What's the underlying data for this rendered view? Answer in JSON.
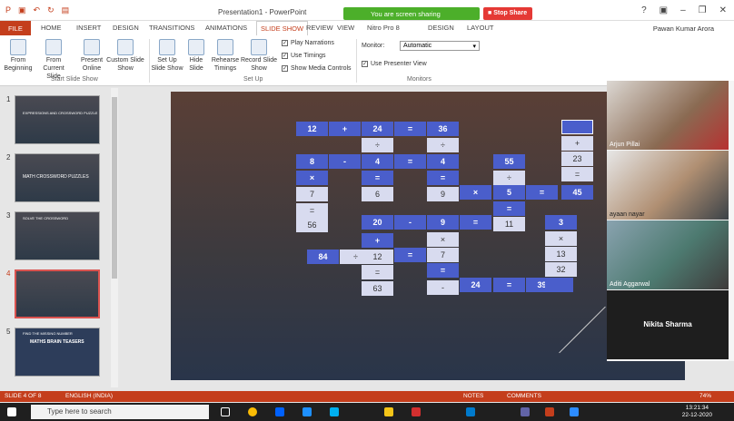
{
  "window": {
    "title": "Presentation1 - PowerPoint",
    "user": "Pawan Kumar Arora"
  },
  "sharing": {
    "status": "You are screen sharing",
    "stop": "Stop Share"
  },
  "tabs": [
    "FILE",
    "HOME",
    "INSERT",
    "DESIGN",
    "TRANSITIONS",
    "ANIMATIONS",
    "SLIDE SHOW",
    "REVIEW",
    "VIEW",
    "Nitro Pro 8",
    "DESIGN",
    "LAYOUT"
  ],
  "ribbon": {
    "from_beginning": "From Beginning",
    "from_current": "From Current Slide",
    "present_online": "Present Online",
    "custom_show": "Custom Slide Show",
    "group_start": "Start Slide Show",
    "set_up": "Set Up Slide Show",
    "hide": "Hide Slide",
    "rehearse": "Rehearse Timings",
    "record": "Record Slide Show",
    "play_narrations": "Play Narrations",
    "use_timings": "Use Timings",
    "show_media": "Show Media Controls",
    "group_setup": "Set Up",
    "monitor_label": "Monitor:",
    "monitor_value": "Automatic",
    "presenter_view": "Use Presenter View",
    "group_monitors": "Monitors"
  },
  "thumbs": {
    "t1": "EXPRESSIONS AND CROSSWORD PUZZLE",
    "t2": "MATH CROSSWORD PUZZLES",
    "t3": "SOLVE THE CROSSWORD",
    "t5a": "FIND THE MISSING NUMBER",
    "t5b": "MATHS BRAIN TEASERS"
  },
  "puzzle": [
    "12",
    "+",
    "24",
    "=",
    "36",
    "÷",
    "÷",
    "8",
    "-",
    "4",
    "=",
    "4",
    "55",
    "+",
    "23",
    "=",
    "×",
    "=",
    "=",
    "÷",
    "7",
    "6",
    "9",
    "×",
    "5",
    "=",
    "45",
    "=",
    "=",
    "56",
    "20",
    "-",
    "9",
    "=",
    "11",
    "3",
    "+",
    "×",
    "×",
    "84",
    "÷",
    "12",
    "=",
    "7",
    "13",
    "=",
    "=",
    "32",
    "63",
    "-",
    "24",
    "=",
    "39"
  ],
  "participants": [
    "Arjun Pillai",
    "ayaan nayar",
    "Aditi Aggarwal",
    "Nikita Sharma"
  ],
  "status": {
    "slide": "SLIDE 4 OF 8",
    "lang": "ENGLISH (INDIA)",
    "notes": "NOTES",
    "comments": "COMMENTS",
    "zoom": "74%"
  },
  "taskbar": {
    "search": "Type here to search",
    "time": "13:21:34",
    "date": "22-12-2020"
  }
}
